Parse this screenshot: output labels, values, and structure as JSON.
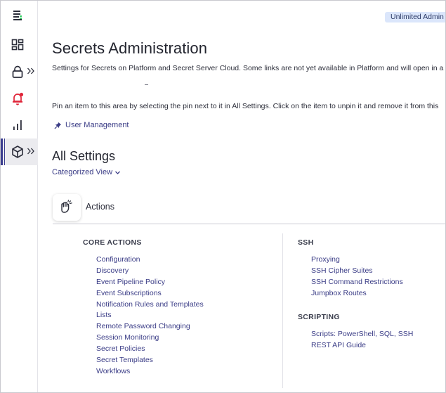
{
  "badge": {
    "text": "Unlimited Admin M"
  },
  "sidebar": {
    "items": [
      {
        "icon": "secret-server-logo-icon"
      },
      {
        "icon": "dashboard-grid-icon"
      },
      {
        "icon": "lock-icon",
        "expandable": true
      },
      {
        "icon": "bell-alert-icon"
      },
      {
        "icon": "bar-chart-icon"
      },
      {
        "icon": "cube-icon",
        "expandable": true,
        "active": true
      }
    ],
    "accent": "#3b3d8f",
    "alert_color": "#e0263a"
  },
  "header": {
    "title": "Secrets Administration",
    "description": "Settings for Secrets on Platform and Secret Server Cloud. Some links are not yet available in Platform and will open in a"
  },
  "pinned": {
    "hint": "Pin an item to this area by selecting the pin next to it in All Settings. Click on the item to unpin it and remove it from this",
    "items": [
      {
        "label": "User Management"
      }
    ]
  },
  "all_settings": {
    "title": "All Settings",
    "view_label": "Categorized View"
  },
  "actions": {
    "label": "Actions",
    "core": {
      "heading": "CORE ACTIONS",
      "links": [
        "Configuration",
        "Discovery",
        "Event Pipeline Policy",
        "Event Subscriptions",
        "Notification Rules and Templates",
        "Lists",
        "Remote Password Changing",
        "Session Monitoring",
        "Secret Policies",
        "Secret Templates",
        "Workflows"
      ]
    },
    "ssh": {
      "heading": "SSH",
      "links": [
        "Proxying",
        "SSH Cipher Suites",
        "SSH Command Restrictions",
        "Jumpbox Routes"
      ]
    },
    "scripting": {
      "heading": "SCRIPTING",
      "links": [
        "Scripts: PowerShell, SQL, SSH",
        "REST API Guide"
      ]
    }
  }
}
